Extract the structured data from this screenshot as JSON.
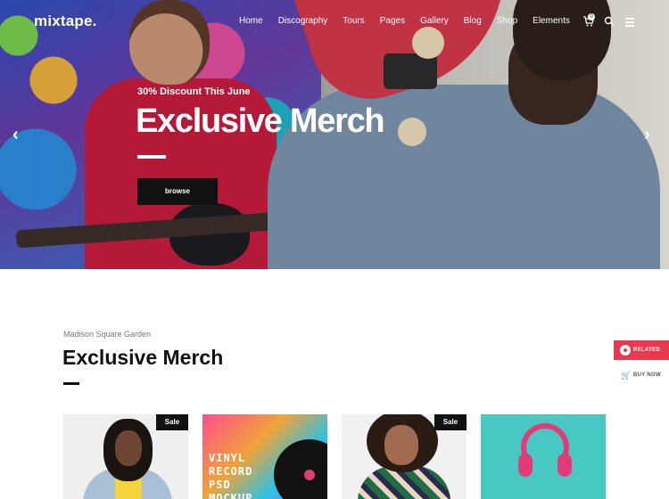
{
  "brand": {
    "logo": "mixtape."
  },
  "nav": {
    "items": [
      "Home",
      "Discography",
      "Tours",
      "Pages",
      "Gallery",
      "Blog",
      "Shop",
      "Elements"
    ],
    "cart_count": "0",
    "cart_icon": "cart-icon",
    "search_icon": "search-icon",
    "menu_icon": "hamburger-menu-icon"
  },
  "hero": {
    "eyebrow": "30% Discount This June",
    "title": "Exclusive Merch",
    "button": "browse",
    "prev_arrow": "‹",
    "next_arrow": "›"
  },
  "section": {
    "subheading": "Madison Square Garden",
    "title": "Exclusive Merch"
  },
  "side": {
    "related": "RELATED",
    "buy_now": "BUY NOW"
  },
  "products": [
    {
      "badge": "Sale"
    },
    {
      "art_text": "VINYL RECORD PSD MOCKUP"
    },
    {
      "badge": "Sale"
    },
    {}
  ],
  "colors": {
    "accent": "#e8394f",
    "dark": "#111111",
    "white": "#ffffff"
  }
}
